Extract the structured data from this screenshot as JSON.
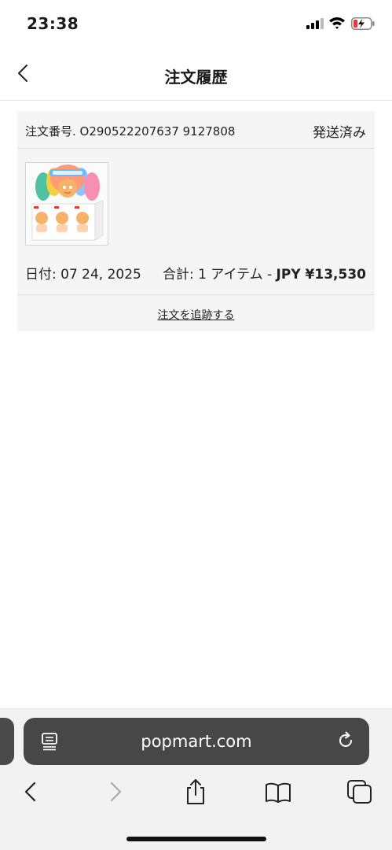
{
  "status_bar": {
    "time": "23:38",
    "icons": [
      "signal-icon",
      "wifi-icon",
      "battery-charging-icon"
    ],
    "battery_color": "#e53935"
  },
  "header": {
    "back_icon": "chevron-left-icon",
    "title": "注文履歴"
  },
  "order": {
    "number_label": "注文番号. O290522207637 9127808",
    "status": "発送済み",
    "product_image": "product-blind-box-image",
    "date": "日付: 07 24, 2025",
    "total_prefix": "合計: 1 アイテム - ",
    "total_price": "JPY ¥13,530",
    "track_link": "注文を追跡する"
  },
  "browser": {
    "url": "popmart.com",
    "reader_icon": "reader-mode-icon",
    "reload_icon": "reload-icon",
    "toolbar_icons": [
      "back-arrow-icon",
      "forward-arrow-icon",
      "share-icon",
      "bookmarks-icon",
      "tabs-icon"
    ]
  }
}
